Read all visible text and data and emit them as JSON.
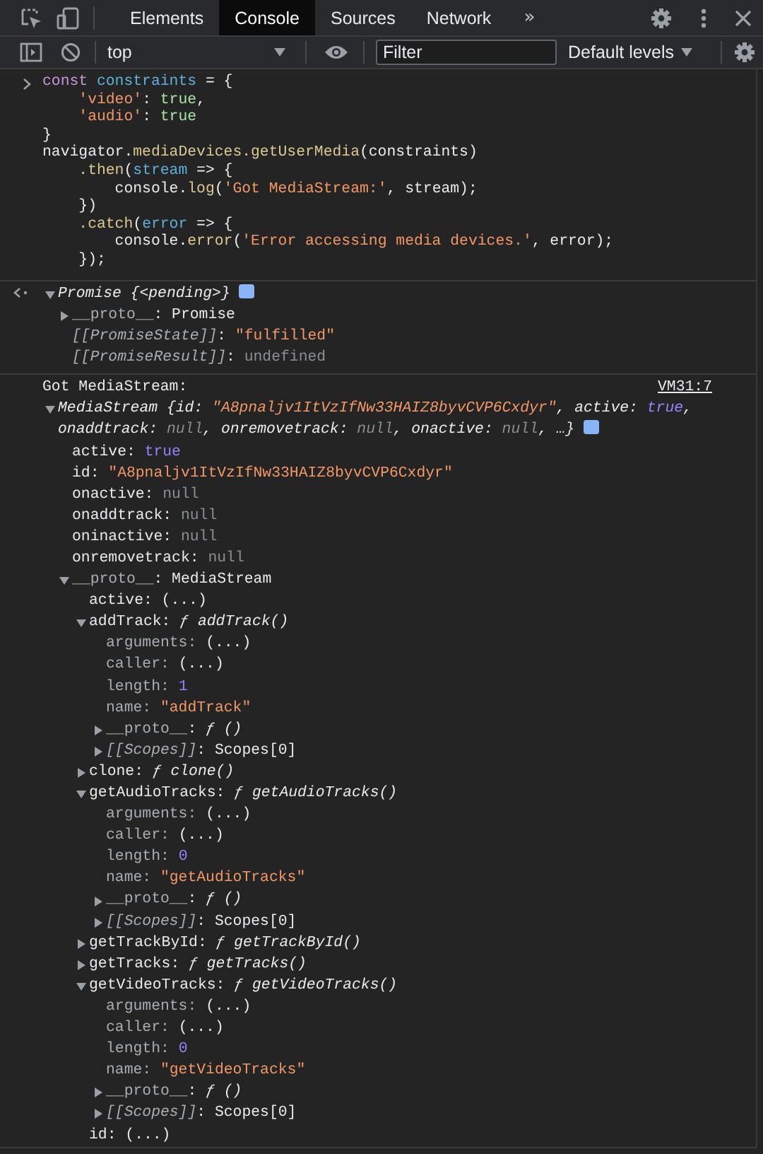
{
  "toolbar": {
    "tabs": [
      {
        "label": "Elements",
        "selected": false
      },
      {
        "label": "Console",
        "selected": true
      },
      {
        "label": "Sources",
        "selected": false
      },
      {
        "label": "Network",
        "selected": false
      }
    ],
    "more": "»"
  },
  "console_toolbar": {
    "context": "top",
    "filter": {
      "placeholder": "Filter"
    },
    "levels": "Default levels"
  },
  "messages": [
    {
      "kind": "input",
      "lines": [
        [
          {
            "text": "const ",
            "kind": "keyword"
          },
          {
            "text": "constraints",
            "kind": "def"
          },
          {
            "text": " = {",
            "kind": "plain"
          }
        ],
        [
          {
            "text": "    'video'",
            "kind": "str"
          },
          {
            "text": ": ",
            "kind": "plain"
          },
          {
            "text": "true",
            "kind": "lit"
          },
          {
            "text": ",",
            "kind": "plain"
          }
        ],
        [
          {
            "text": "    'audio'",
            "kind": "str"
          },
          {
            "text": ": ",
            "kind": "plain"
          },
          {
            "text": "true",
            "kind": "lit"
          }
        ],
        [
          {
            "text": "}",
            "kind": "plain"
          }
        ],
        [
          {
            "text": "navigator.",
            "kind": "plain"
          },
          {
            "text": "mediaDevices.getUserMedia",
            "kind": "prop"
          },
          {
            "text": "(constraints)",
            "kind": "plain"
          }
        ],
        [
          {
            "text": "    .then",
            "kind": "prop"
          },
          {
            "text": "(",
            "kind": "plain"
          },
          {
            "text": "stream",
            "kind": "def"
          },
          {
            "text": " => {",
            "kind": "plain"
          }
        ],
        [
          {
            "text": "        console.",
            "kind": "plain"
          },
          {
            "text": "log",
            "kind": "prop"
          },
          {
            "text": "(",
            "kind": "plain"
          },
          {
            "text": "'Got MediaStream:'",
            "kind": "str"
          },
          {
            "text": ", stream);",
            "kind": "plain"
          }
        ],
        [
          {
            "text": "    })",
            "kind": "plain"
          }
        ],
        [
          {
            "text": "    .catch",
            "kind": "prop"
          },
          {
            "text": "(",
            "kind": "plain"
          },
          {
            "text": "error",
            "kind": "def"
          },
          {
            "text": " => {",
            "kind": "plain"
          }
        ],
        [
          {
            "text": "        console.",
            "kind": "plain"
          },
          {
            "text": "error",
            "kind": "prop"
          },
          {
            "text": "(",
            "kind": "plain"
          },
          {
            "text": "'Error accessing media devices.'",
            "kind": "str"
          },
          {
            "text": ", error);",
            "kind": "plain"
          }
        ],
        [
          {
            "text": "    });",
            "kind": "plain"
          }
        ]
      ]
    },
    {
      "kind": "result",
      "tree": {
        "parts": [
          {
            "text": "Promise {<pending>}",
            "kind": "plain"
          }
        ],
        "expanded": true,
        "children": [
          {
            "parts": [
              {
                "text": "__proto__",
                "kind": "dim"
              },
              {
                "text": ": Promise",
                "kind": "plain"
              }
            ],
            "expanded": false
          },
          {
            "parts": [
              {
                "text": "[[PromiseState]]",
                "kind": "internal"
              },
              {
                "text": ": ",
                "kind": "plain"
              },
              {
                "text": "\"fulfilled\"",
                "kind": "str"
              }
            ]
          },
          {
            "parts": [
              {
                "text": "[[PromiseResult]]",
                "kind": "internal"
              },
              {
                "text": ": ",
                "kind": "plain"
              },
              {
                "text": "undefined",
                "kind": "null"
              }
            ]
          }
        ]
      }
    },
    {
      "kind": "log",
      "text": "Got MediaStream:",
      "source": "VM31:7",
      "tree": {
        "parts": [
          {
            "text": "MediaStream {id: ",
            "kind": "plain"
          },
          {
            "text": "\"A8pnaljv1ItVzIfNw33HAIZ8byvCVP6Cxdyr\"",
            "kind": "str"
          },
          {
            "text": ", active: ",
            "kind": "plain"
          },
          {
            "text": "true",
            "kind": "num"
          },
          {
            "text": ", onaddtrack: ",
            "kind": "plain"
          },
          {
            "text": "null",
            "kind": "null"
          },
          {
            "text": ", onremovetrack: ",
            "kind": "plain"
          },
          {
            "text": "null",
            "kind": "null"
          },
          {
            "text": ", onactive: ",
            "kind": "plain"
          },
          {
            "text": "null",
            "kind": "null"
          },
          {
            "text": ", …}",
            "kind": "plain"
          }
        ],
        "expanded": true,
        "children": [
          {
            "parts": [
              {
                "text": "active: ",
                "kind": "key"
              },
              {
                "text": "true",
                "kind": "num"
              }
            ]
          },
          {
            "parts": [
              {
                "text": "id: ",
                "kind": "key"
              },
              {
                "text": "\"A8pnaljv1ItVzIfNw33HAIZ8byvCVP6Cxdyr\"",
                "kind": "str"
              }
            ]
          },
          {
            "parts": [
              {
                "text": "onactive: ",
                "kind": "key"
              },
              {
                "text": "null",
                "kind": "null"
              }
            ]
          },
          {
            "parts": [
              {
                "text": "onaddtrack: ",
                "kind": "key"
              },
              {
                "text": "null",
                "kind": "null"
              }
            ]
          },
          {
            "parts": [
              {
                "text": "oninactive: ",
                "kind": "key"
              },
              {
                "text": "null",
                "kind": "null"
              }
            ]
          },
          {
            "parts": [
              {
                "text": "onremovetrack: ",
                "kind": "key"
              },
              {
                "text": "null",
                "kind": "null"
              }
            ]
          },
          {
            "parts": [
              {
                "text": "__proto__",
                "kind": "dim"
              },
              {
                "text": ": MediaStream",
                "kind": "plain"
              }
            ],
            "expanded": true,
            "children": [
              {
                "parts": [
                  {
                    "text": "active: (...)",
                    "kind": "key"
                  }
                ]
              },
              {
                "parts": [
                  {
                    "text": "addTrack: ",
                    "kind": "key"
                  },
                  {
                    "text": "ƒ addTrack()",
                    "kind": "fn"
                  }
                ],
                "expanded": true,
                "children": [
                  {
                    "parts": [
                      {
                        "text": "arguments: ",
                        "kind": "dim"
                      },
                      {
                        "text": "(...)",
                        "kind": "plain"
                      }
                    ]
                  },
                  {
                    "parts": [
                      {
                        "text": "caller: ",
                        "kind": "dim"
                      },
                      {
                        "text": "(...)",
                        "kind": "plain"
                      }
                    ]
                  },
                  {
                    "parts": [
                      {
                        "text": "length: ",
                        "kind": "dim"
                      },
                      {
                        "text": "1",
                        "kind": "num"
                      }
                    ]
                  },
                  {
                    "parts": [
                      {
                        "text": "name: ",
                        "kind": "dim"
                      },
                      {
                        "text": "\"addTrack\"",
                        "kind": "str"
                      }
                    ]
                  },
                  {
                    "parts": [
                      {
                        "text": "__proto__",
                        "kind": "dim"
                      },
                      {
                        "text": ": ",
                        "kind": "plain"
                      },
                      {
                        "text": "ƒ ()",
                        "kind": "fn"
                      }
                    ],
                    "expanded": false
                  },
                  {
                    "parts": [
                      {
                        "text": "[[Scopes]]",
                        "kind": "internal"
                      },
                      {
                        "text": ": Scopes[0]",
                        "kind": "plain"
                      }
                    ],
                    "expanded": false
                  }
                ]
              },
              {
                "parts": [
                  {
                    "text": "clone: ",
                    "kind": "key"
                  },
                  {
                    "text": "ƒ clone()",
                    "kind": "fn"
                  }
                ],
                "expanded": false
              },
              {
                "parts": [
                  {
                    "text": "getAudioTracks: ",
                    "kind": "key"
                  },
                  {
                    "text": "ƒ getAudioTracks()",
                    "kind": "fn"
                  }
                ],
                "expanded": true,
                "children": [
                  {
                    "parts": [
                      {
                        "text": "arguments: ",
                        "kind": "dim"
                      },
                      {
                        "text": "(...)",
                        "kind": "plain"
                      }
                    ]
                  },
                  {
                    "parts": [
                      {
                        "text": "caller: ",
                        "kind": "dim"
                      },
                      {
                        "text": "(...)",
                        "kind": "plain"
                      }
                    ]
                  },
                  {
                    "parts": [
                      {
                        "text": "length: ",
                        "kind": "dim"
                      },
                      {
                        "text": "0",
                        "kind": "num"
                      }
                    ]
                  },
                  {
                    "parts": [
                      {
                        "text": "name: ",
                        "kind": "dim"
                      },
                      {
                        "text": "\"getAudioTracks\"",
                        "kind": "str"
                      }
                    ]
                  },
                  {
                    "parts": [
                      {
                        "text": "__proto__",
                        "kind": "dim"
                      },
                      {
                        "text": ": ",
                        "kind": "plain"
                      },
                      {
                        "text": "ƒ ()",
                        "kind": "fn"
                      }
                    ],
                    "expanded": false
                  },
                  {
                    "parts": [
                      {
                        "text": "[[Scopes]]",
                        "kind": "internal"
                      },
                      {
                        "text": ": Scopes[0]",
                        "kind": "plain"
                      }
                    ],
                    "expanded": false
                  }
                ]
              },
              {
                "parts": [
                  {
                    "text": "getTrackById: ",
                    "kind": "key"
                  },
                  {
                    "text": "ƒ getTrackById()",
                    "kind": "fn"
                  }
                ],
                "expanded": false
              },
              {
                "parts": [
                  {
                    "text": "getTracks: ",
                    "kind": "key"
                  },
                  {
                    "text": "ƒ getTracks()",
                    "kind": "fn"
                  }
                ],
                "expanded": false
              },
              {
                "parts": [
                  {
                    "text": "getVideoTracks: ",
                    "kind": "key"
                  },
                  {
                    "text": "ƒ getVideoTracks()",
                    "kind": "fn"
                  }
                ],
                "expanded": true,
                "children": [
                  {
                    "parts": [
                      {
                        "text": "arguments: ",
                        "kind": "dim"
                      },
                      {
                        "text": "(...)",
                        "kind": "plain"
                      }
                    ]
                  },
                  {
                    "parts": [
                      {
                        "text": "caller: ",
                        "kind": "dim"
                      },
                      {
                        "text": "(...)",
                        "kind": "plain"
                      }
                    ]
                  },
                  {
                    "parts": [
                      {
                        "text": "length: ",
                        "kind": "dim"
                      },
                      {
                        "text": "0",
                        "kind": "num"
                      }
                    ]
                  },
                  {
                    "parts": [
                      {
                        "text": "name: ",
                        "kind": "dim"
                      },
                      {
                        "text": "\"getVideoTracks\"",
                        "kind": "str"
                      }
                    ]
                  },
                  {
                    "parts": [
                      {
                        "text": "__proto__",
                        "kind": "dim"
                      },
                      {
                        "text": ": ",
                        "kind": "plain"
                      },
                      {
                        "text": "ƒ ()",
                        "kind": "fn"
                      }
                    ],
                    "expanded": false
                  },
                  {
                    "parts": [
                      {
                        "text": "[[Scopes]]",
                        "kind": "internal"
                      },
                      {
                        "text": ": Scopes[0]",
                        "kind": "plain"
                      }
                    ],
                    "expanded": false
                  }
                ]
              },
              {
                "parts": [
                  {
                    "text": "id: (...)",
                    "kind": "key"
                  }
                ]
              }
            ]
          }
        ]
      }
    }
  ]
}
